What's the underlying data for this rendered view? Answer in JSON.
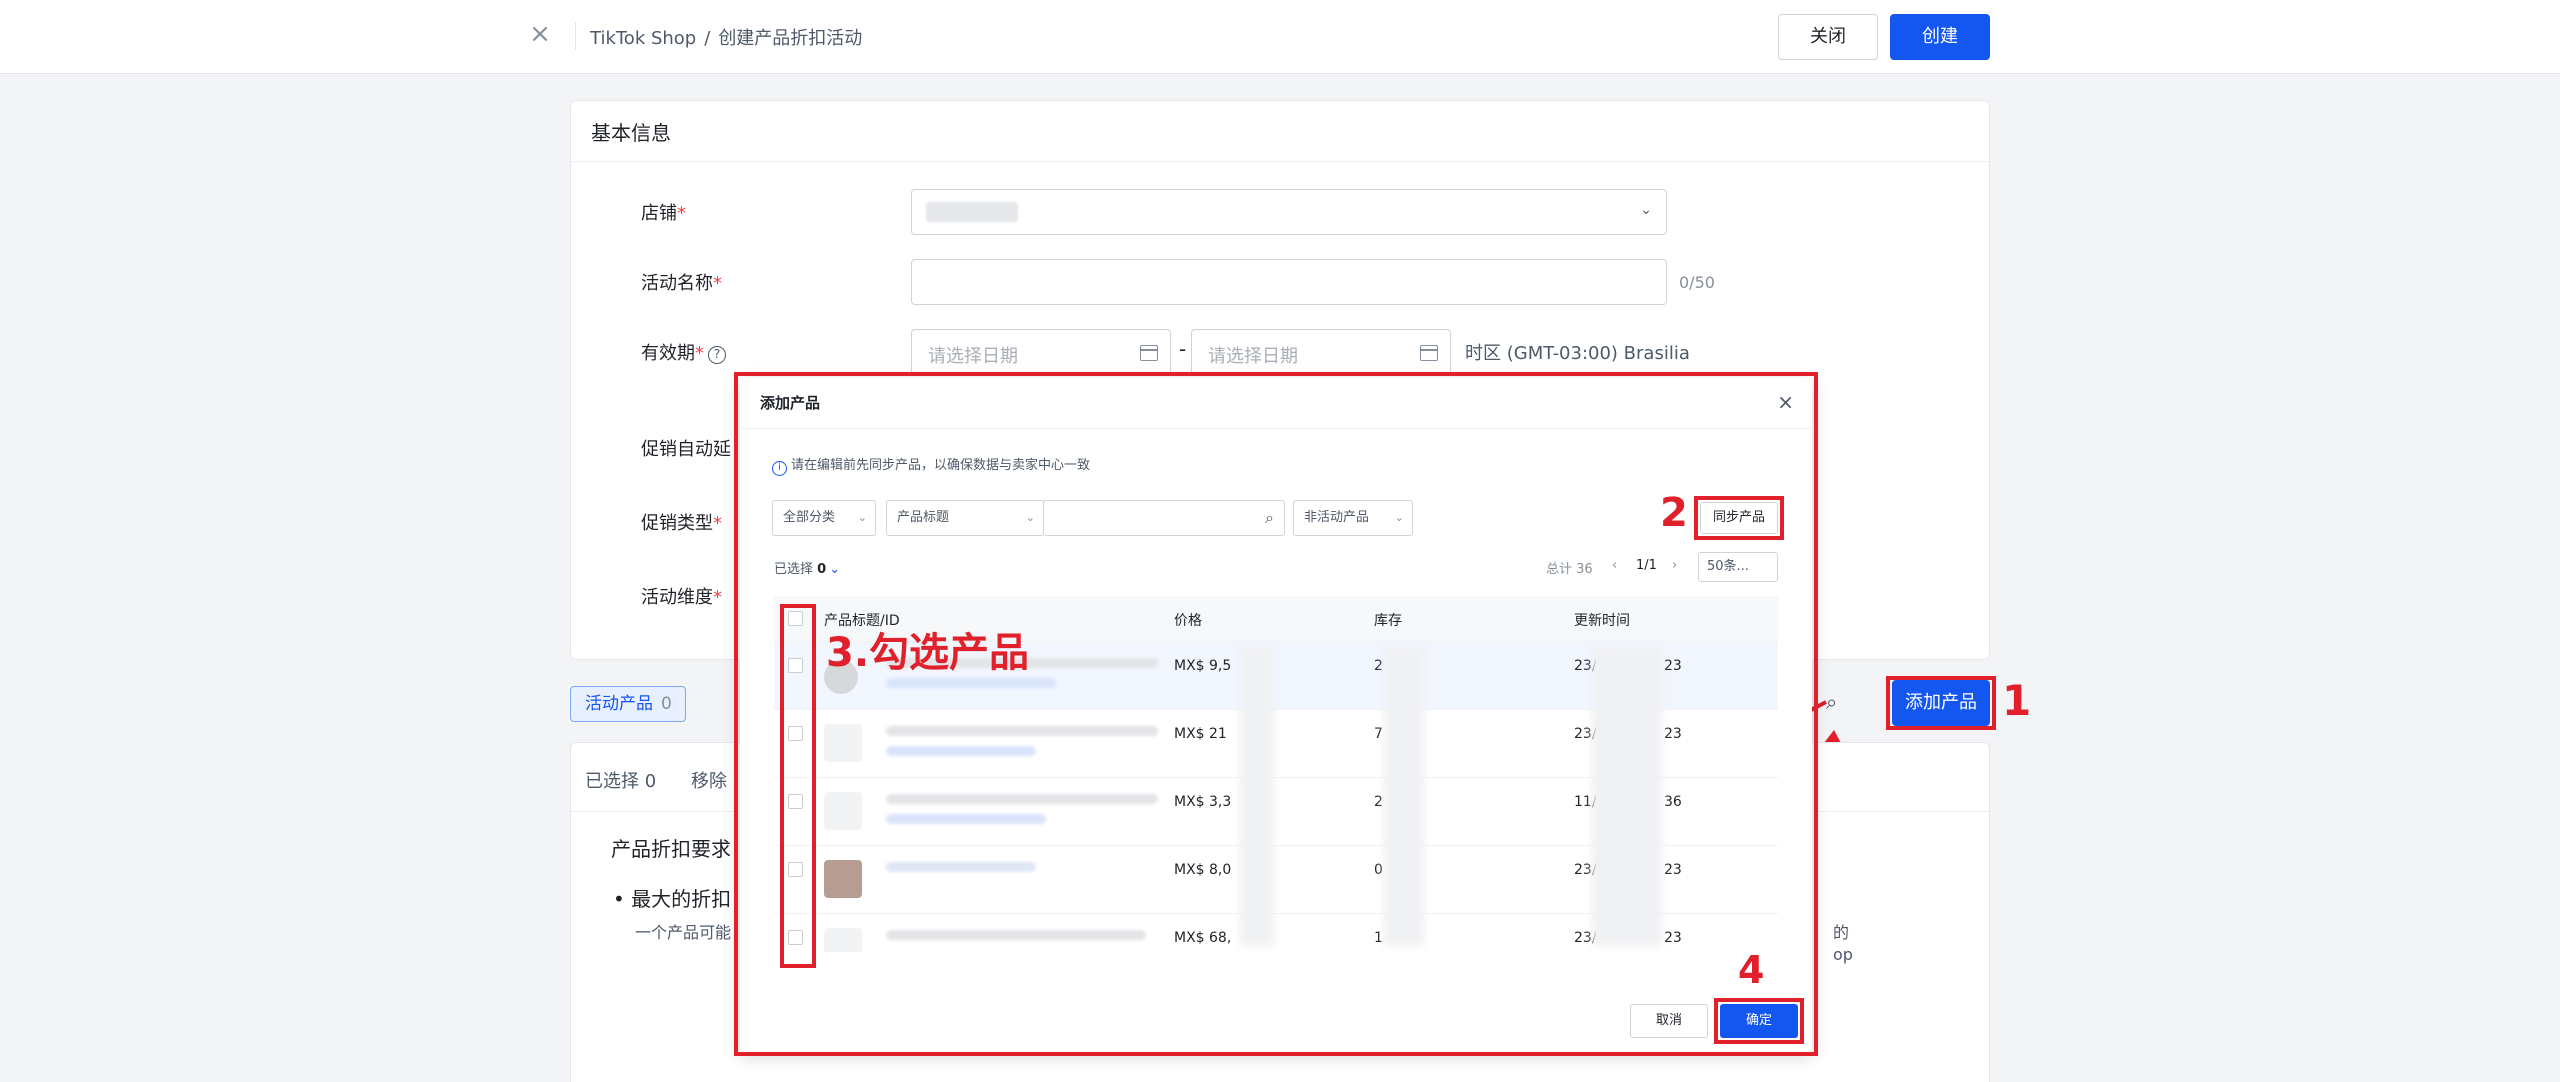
{
  "topbar": {
    "breadcrumb_root": "TikTok Shop",
    "breadcrumb_sep": "/",
    "breadcrumb_current": "创建产品折扣活动",
    "close_label": "关闭",
    "create_label": "创建"
  },
  "basic_info": {
    "title": "基本信息",
    "store_label": "店铺",
    "activity_name_label": "活动名称",
    "activity_name_counter": "0/50",
    "validity_label": "有效期",
    "date_start_placeholder": "请选择日期",
    "date_end_placeholder": "请选择日期",
    "date_dash": "-",
    "timezone": "时区 (GMT-03:00) Brasilia",
    "auto_extend_label": "促销自动延",
    "promo_type_label": "促销类型",
    "dimension_label": "活动维度",
    "required_mark": "*"
  },
  "activity_products": {
    "tab_label": "活动产品",
    "tab_count": "0",
    "add_button_label": "添加产品",
    "selected_prefix": "已选择",
    "selected_count": "0",
    "remove_label": "移除",
    "req_title": "产品折扣要求",
    "bullet_text": "最大的折扣",
    "sub_text": "一个产品可能",
    "right_frag_1": "的",
    "right_frag_2": "op"
  },
  "modal": {
    "title": "添加产品",
    "info_text": "请在编辑前先同步产品，以确保数据与卖家中心一致",
    "category_select": "全部分类",
    "title_select": "产品标题",
    "status_select": "非活动产品",
    "sync_button": "同步产品",
    "selected_prefix": "已选择",
    "selected_count": "0",
    "total_text": "总计 36",
    "page_text": "1/1",
    "per_page": "50条...",
    "columns": [
      "产品标题/ID",
      "价格",
      "库存",
      "更新时间"
    ],
    "rows": [
      {
        "price": "MX$ 9,5",
        "stock": "2",
        "updated_a": "23/",
        "updated_b": "23"
      },
      {
        "price": "MX$ 21",
        "stock": "7",
        "updated_a": "23/",
        "updated_b": "23"
      },
      {
        "price": "MX$ 3,3",
        "stock": "2",
        "updated_a": "11/",
        "updated_b": "36"
      },
      {
        "price": "MX$ 8,0",
        "stock": "0",
        "updated_a": "23/",
        "updated_b": "23"
      },
      {
        "price": "MX$ 68,",
        "stock": "1",
        "updated_a": "23/",
        "updated_b": "23"
      }
    ],
    "cancel_label": "取消",
    "ok_label": "确定"
  },
  "annotations": {
    "step1": "1",
    "step2": "2",
    "step3": "3.勾选产品",
    "step4": "4"
  },
  "colors": {
    "primary": "#1456f0",
    "annotation_red": "#e0202a",
    "required": "#f53f3f"
  }
}
